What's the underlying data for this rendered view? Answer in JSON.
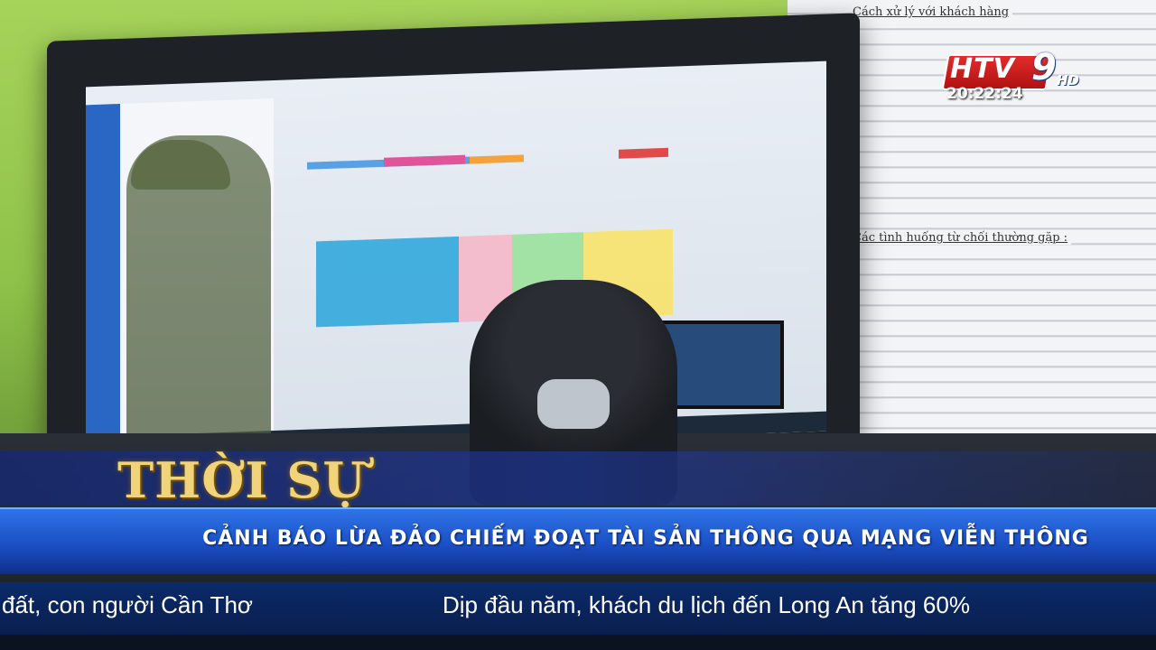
{
  "broadcast": {
    "channel_logo_text": "HTV",
    "channel_logo_number": "9",
    "channel_logo_suffix": "HD",
    "clock": "20:22:24"
  },
  "program": {
    "title": "THỜI SỰ"
  },
  "headline": {
    "text": "CẢNH BÁO LỪA ĐẢO CHIẾM ĐOẠT TÀI SẢN THÔNG QUA MẠNG VIỄN THÔNG"
  },
  "ticker": {
    "items": [
      "đất, con người Cần Thơ",
      "Dịp đầu năm, khách du lịch đến Long An tăng 60%"
    ]
  },
  "background_document": {
    "heading_1": "Cách xử lý với khách hàng",
    "heading_2": "Các tình huống từ chối thường gặp :"
  },
  "colors": {
    "headline_bar": "#1b4fc4",
    "program_title_gold": "#f1d47a",
    "logo_red": "#e42b2b"
  }
}
